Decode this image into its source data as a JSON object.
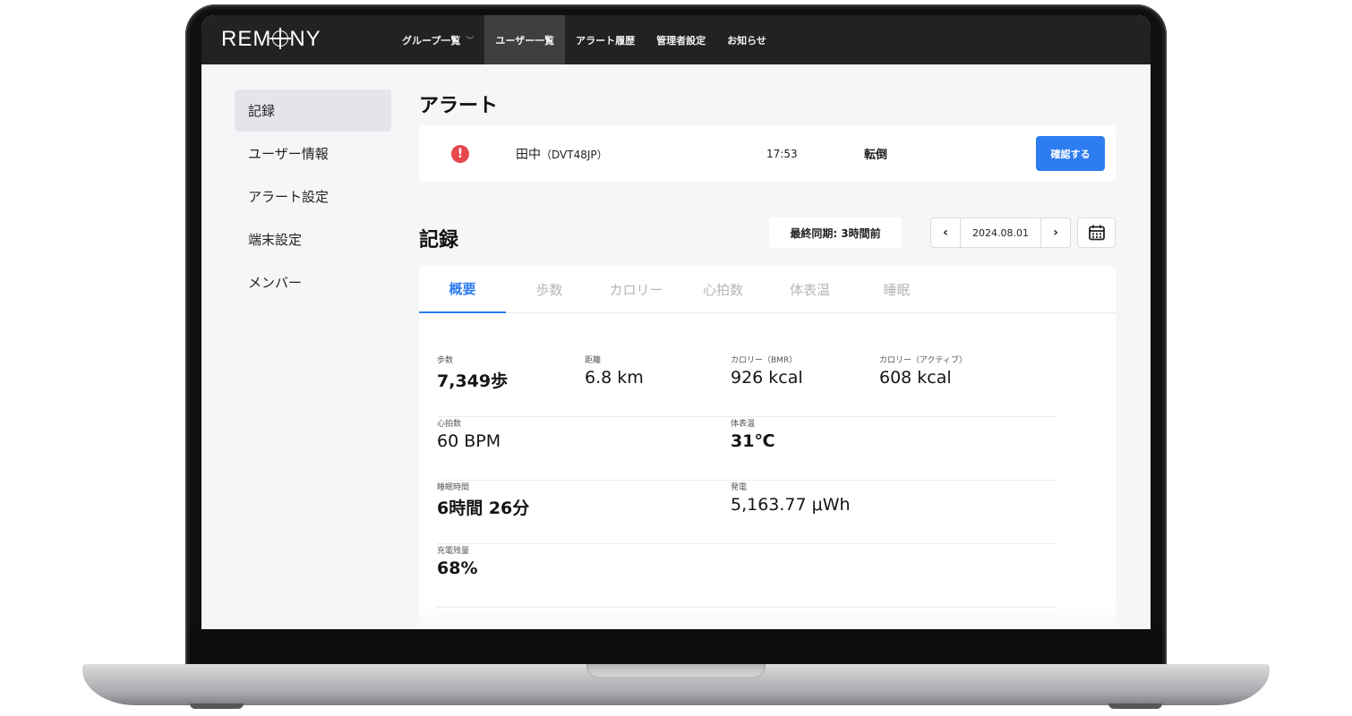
{
  "brand": {
    "logo_left": "REM",
    "logo_right": "NY"
  },
  "topnav": {
    "items": [
      {
        "label": "グループ一覧",
        "has_dropdown": true,
        "active": false
      },
      {
        "label": "ユーザー一覧",
        "active": true
      },
      {
        "label": "アラート履歴",
        "active": false
      },
      {
        "label": "管理者設定",
        "active": false
      },
      {
        "label": "お知らせ",
        "active": false
      }
    ],
    "dropdown_glyph": "﹀"
  },
  "sidebar": {
    "items": [
      {
        "label": "記録",
        "active": true
      },
      {
        "label": "ユーザー情報"
      },
      {
        "label": "アラート設定"
      },
      {
        "label": "端末設定"
      },
      {
        "label": "メンバー"
      }
    ]
  },
  "alert_section": {
    "title": "アラート",
    "alert": {
      "icon": "alert-exclamation-icon",
      "icon_glyph": "!",
      "user_name": "田中",
      "device_code": "（DVT48JP）",
      "time": "17:53",
      "type": "転倒",
      "confirm_label": "確認する"
    }
  },
  "records": {
    "title": "記録",
    "sync_status": "最終同期: 3時間前",
    "date": "2024.08.01",
    "prev_glyph": "‹",
    "next_glyph": "›",
    "calendar_icon": "calendar-icon",
    "tabs": [
      {
        "label": "概要",
        "active": true
      },
      {
        "label": "歩数"
      },
      {
        "label": "カロリー"
      },
      {
        "label": "心拍数"
      },
      {
        "label": "体表温"
      },
      {
        "label": "睡眠"
      }
    ],
    "metrics": {
      "steps": {
        "label": "歩数",
        "value": "7,349歩"
      },
      "distance": {
        "label": "距離",
        "value": "6.8 km"
      },
      "calorie_bmr": {
        "label": "カロリー（BMR）",
        "value": "926 kcal"
      },
      "calorie_active": {
        "label": "カロリー（アクティブ）",
        "value": "608 kcal"
      },
      "heart_rate": {
        "label": "心拍数",
        "value": "60 BPM"
      },
      "body_temp": {
        "label": "体表温",
        "value": "31℃"
      },
      "sleep": {
        "label": "睡眠時間",
        "value": "6時間 26分"
      },
      "power": {
        "label": "発電",
        "value": "5,163.77 μWh"
      },
      "battery": {
        "label": "充電残量",
        "value": "68%"
      }
    }
  },
  "colors": {
    "accent": "#2e7df0",
    "alert_red": "#e5484d",
    "nav_bg": "#222222",
    "nav_active_bg": "#3f3f3f",
    "page_bg": "#f5f6f8"
  }
}
